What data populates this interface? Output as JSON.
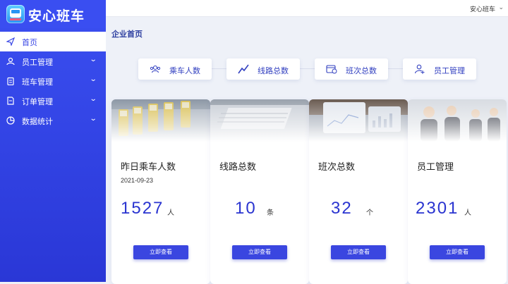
{
  "app": {
    "title": "安心班车"
  },
  "user": {
    "name": "安心班车"
  },
  "sidebar": {
    "items": [
      {
        "label": "首页"
      },
      {
        "label": "员工管理"
      },
      {
        "label": "班车管理"
      },
      {
        "label": "订单管理"
      },
      {
        "label": "数据统计"
      }
    ]
  },
  "page": {
    "title": "企业首页"
  },
  "quick": [
    {
      "label": "乘车人数",
      "icon": "passengers-icon"
    },
    {
      "label": "线路总数",
      "icon": "trend-line-icon"
    },
    {
      "label": "班次总数",
      "icon": "schedule-icon"
    },
    {
      "label": "员工管理",
      "icon": "add-user-icon"
    }
  ],
  "cards": [
    {
      "title": "昨日乘车人数",
      "date": "2021-09-23",
      "value": "1527",
      "unit": "人",
      "button": "立即查看"
    },
    {
      "title": "线路总数",
      "value": "10",
      "unit": "条",
      "button": "立即查看"
    },
    {
      "title": "班次总数",
      "value": "32",
      "unit": "个",
      "button": "立即查看"
    },
    {
      "title": "员工管理",
      "value": "2301",
      "unit": "人",
      "button": "立即查看"
    }
  ],
  "colors": {
    "accent": "#3a46e0",
    "sidebar": "#3345e6",
    "title": "#2d3fa0"
  }
}
